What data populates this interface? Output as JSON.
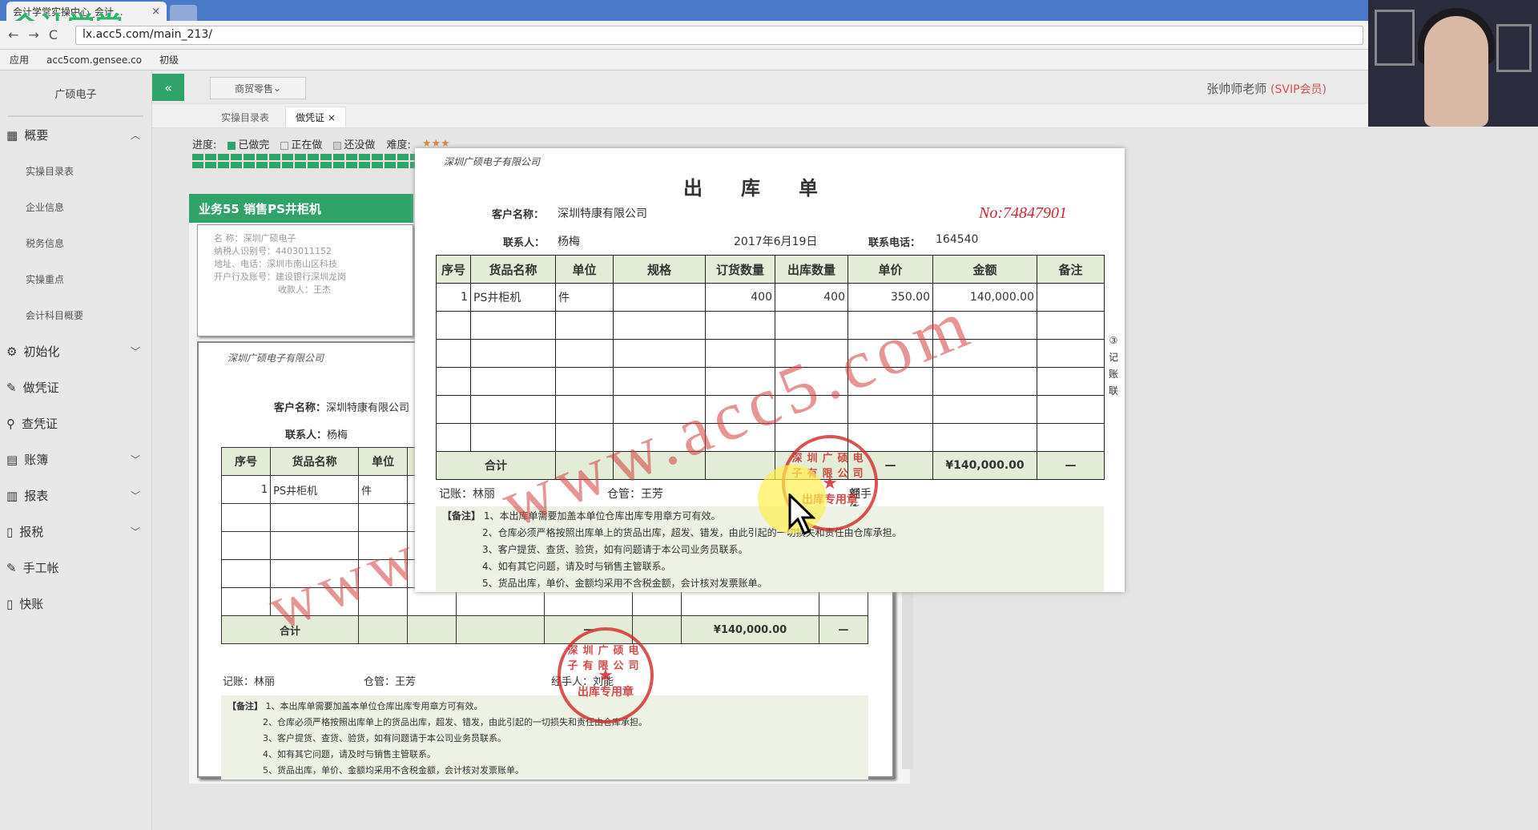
{
  "browser": {
    "tab_title": "会计学堂实操中心_会计...",
    "tab_close": "×",
    "logo": "会计学堂",
    "url": "lx.acc5.com/main_213/",
    "bookmarks": [
      "应用",
      "acc5com.gensee.co",
      "初级"
    ]
  },
  "header": {
    "collapse_icon": "«",
    "dropdown": "商贸零售",
    "user": "张帅师老师",
    "badge": "(SVIP会员)"
  },
  "sidebar": {
    "company": "广硕电子",
    "menu_overview": "概要",
    "sub_items": [
      "实操目录表",
      "企业信息",
      "税务信息",
      "实操重点",
      "会计科目概要"
    ],
    "menu_items": [
      {
        "label": "初始化"
      },
      {
        "label": "做凭证"
      },
      {
        "label": "查凭证"
      },
      {
        "label": "账簿"
      },
      {
        "label": "报表"
      },
      {
        "label": "报税"
      },
      {
        "label": "手工帐"
      },
      {
        "label": "快账"
      }
    ]
  },
  "tabs": [
    "实操目录表",
    "做凭证"
  ],
  "progress": {
    "label": "进度:",
    "done": "已做完",
    "doing": "正在做",
    "todo": "还没做",
    "difficulty": "难度:",
    "stars": "★★★"
  },
  "task": {
    "title": "业务55 销售PS井柜机"
  },
  "bg_invoice": {
    "lines": [
      "名     称：深圳广硕电子",
      "纳税人识别号：4403011152",
      "地址、电话：深圳市南山区科技",
      "开户行及账号：建设银行深圳龙岗"
    ],
    "payee": "收款人：王杰"
  },
  "doc": {
    "company": "深圳广硕电子有限公司",
    "title": "出库单",
    "number": "No:74847901",
    "customer_label": "客户名称：",
    "customer": "深圳特康有限公司",
    "contact_label": "联系人：",
    "contact": "杨梅",
    "date": "2017年6月19日",
    "phone_label": "联系电话：",
    "phone": "164540",
    "headers": [
      "序号",
      "货品名称",
      "单位",
      "规格",
      "订货数量",
      "出库数量",
      "单价",
      "金额",
      "备注"
    ],
    "rows": [
      {
        "seq": "1",
        "name": "PS井柜机",
        "unit": "件",
        "spec": "",
        "ordered": "400",
        "shipped": "400",
        "price": "350.00",
        "amount": "140,000.00",
        "note": ""
      }
    ],
    "sum_label": "合计",
    "sum_dash": "—",
    "sum_amount": "¥140,000.00",
    "sum_note": "—",
    "copy_label": "③记账联",
    "bookkeeper": "记账：林丽",
    "warehouse": "仓管：王芳",
    "handler_label": "经手人：",
    "handler": "刘能",
    "notes_label": "【备注】",
    "notes": [
      "1、本出库单需要加盖本单位仓库出库专用章方可有效。",
      "2、仓库必须严格按照出库单上的货品出库，超发、错发，由此引起的一切损失和责任由仓库承担。",
      "3、客户提货、查货、验货，如有问题请于本公司业务员联系。",
      "4、如有其它问题，请及时与销售主管联系。",
      "5、货品出库，单价、金额均采用不含税金额，会计核对发票账单。"
    ],
    "watermark": "www.acc5.com",
    "stamp_text": "出库专用章",
    "stamp_arc": "深圳广硕电子有限公司"
  }
}
